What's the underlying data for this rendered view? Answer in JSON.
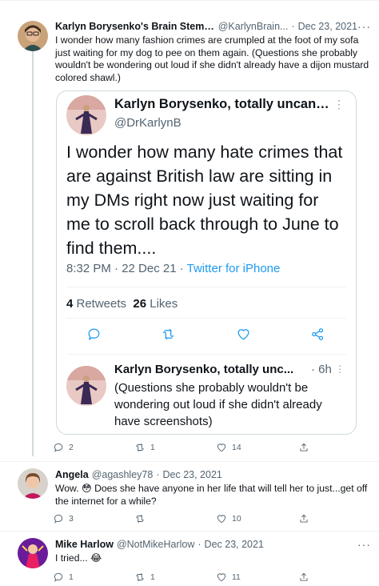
{
  "tweets": [
    {
      "name": "Karlyn Borysenko's Brain Stem & ...",
      "handle": "@KarlynBrain...",
      "sep": "·",
      "date": "Dec 23, 2021",
      "more": "···",
      "text": "I wonder how many fashion crimes are crumpled at the foot of my sofa just waiting for my dog to pee on them again. (Questions she probably wouldn't be wondering out loud if she didn't already have a dijon mustard colored shawl.)",
      "reply_count": "2",
      "retweet_count": "1",
      "like_count": "14"
    },
    {
      "name": "Angela",
      "handle": "@agashley78",
      "sep": "·",
      "date": "Dec 23, 2021",
      "more": "···",
      "text_before": "Wow. ",
      "emoji": "😳",
      "text_after": " Does she have anyone in her life that will tell her to just...get off the internet for a while?",
      "reply_count": "3",
      "retweet_count": "",
      "like_count": "10"
    },
    {
      "name": "Mike Harlow",
      "handle": "@NotMikeHarlow",
      "sep": "·",
      "date": "Dec 23, 2021",
      "more": "···",
      "text_before": "I tried... ",
      "emoji": "😂",
      "reply_count": "1",
      "retweet_count": "1",
      "like_count": "11"
    }
  ],
  "quote": {
    "name": "Karlyn Borysenko, totally uncance...",
    "handle": "@DrKarlynB",
    "more": "⋮",
    "text": "I wonder how many hate crimes that are against British law are sitting in my DMs right now just waiting for me to scroll back through to June to find them....",
    "time": "8:32 PM · 22 Dec 21 · ",
    "source": "Twitter for iPhone",
    "retweets": "4",
    "retweets_label": " Retweets",
    "likes": "26",
    "likes_label": " Likes",
    "reply": {
      "name": "Karlyn Borysenko, totally unc...",
      "time": "· 6h",
      "more": "⋮",
      "text": "(Questions she probably wouldn't be wondering out loud if she didn't already have screenshots)"
    }
  },
  "icons": {
    "reply": "reply-icon",
    "retweet": "retweet-icon",
    "like": "heart-icon",
    "share": "share-icon",
    "more": "more-icon"
  },
  "colors": {
    "accent": "#1d9bf0",
    "text": "#0f1419",
    "muted": "#536471",
    "border": "#cfd9de"
  }
}
